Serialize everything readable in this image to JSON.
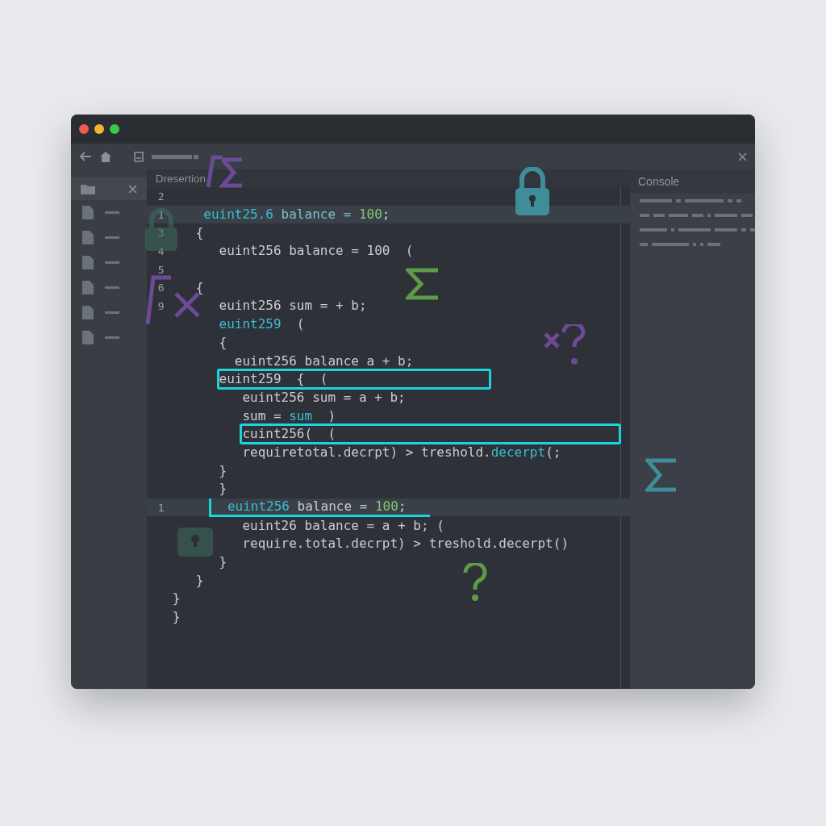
{
  "editor": {
    "tab_title": "Dresertion",
    "lines": [
      {
        "number": "2",
        "highlighted": false
      },
      {
        "number": "1",
        "highlighted": true,
        "tokens": [
          {
            "text": "    euint25.6",
            "kind": "type"
          },
          {
            "text": " balance = ",
            "kind": "ident"
          },
          {
            "text": "100",
            "kind": "number"
          },
          {
            "text": ";",
            "kind": "plain"
          }
        ]
      },
      {
        "number": "3",
        "highlighted": false,
        "tokens": [
          {
            "text": "   {",
            "kind": "plain"
          }
        ]
      },
      {
        "number": "4",
        "highlighted": false,
        "tokens": [
          {
            "text": "      euint256 balance = 100  (",
            "kind": "plain"
          }
        ]
      },
      {
        "number": "5",
        "highlighted": false
      },
      {
        "number": "6",
        "highlighted": false,
        "tokens": [
          {
            "text": "   {",
            "kind": "plain"
          }
        ]
      },
      {
        "number": "9",
        "highlighted": false,
        "tokens": [
          {
            "text": "      euint256 sum = + b;",
            "kind": "plain"
          }
        ]
      },
      {
        "highlighted": false,
        "tokens": [
          {
            "text": "      euint259",
            "kind": "type"
          },
          {
            "text": "  (",
            "kind": "plain"
          }
        ]
      },
      {
        "highlighted": false,
        "tokens": [
          {
            "text": "      {",
            "kind": "plain"
          }
        ]
      },
      {
        "highlighted": false,
        "tokens": [
          {
            "text": "        euint256 balance a + b;",
            "kind": "plain"
          }
        ]
      },
      {
        "highlighted": false,
        "kind": "boxed",
        "tokens": [
          {
            "text": "      euint259  {  (",
            "kind": "plain"
          }
        ]
      },
      {
        "highlighted": false,
        "tokens": [
          {
            "text": "         euint256 sum = a + b;",
            "kind": "plain"
          }
        ]
      },
      {
        "highlighted": false,
        "tokens": [
          {
            "text": "         sum = ",
            "kind": "plain"
          },
          {
            "text": "sum",
            "kind": "type"
          },
          {
            "text": "  )",
            "kind": "plain"
          }
        ]
      },
      {
        "highlighted": false,
        "kind": "wideboxed",
        "tokens": [
          {
            "text": "         cuint256(  (",
            "kind": "plain"
          }
        ]
      },
      {
        "highlighted": false,
        "tokens": [
          {
            "text": "         requiretotal.decrpt) > treshold.",
            "kind": "plain"
          },
          {
            "text": "decerpt",
            "kind": "type"
          },
          {
            "text": "(;",
            "kind": "plain"
          }
        ]
      },
      {
        "highlighted": false,
        "tokens": [
          {
            "text": "      }",
            "kind": "plain"
          }
        ]
      },
      {
        "highlighted": false,
        "tokens": [
          {
            "text": "      }",
            "kind": "plain"
          }
        ]
      },
      {
        "number": "1",
        "highlighted": true,
        "kind": "underlined",
        "tokens": [
          {
            "text": "     euint256",
            "kind": "type"
          },
          {
            "text": " balance = ",
            "kind": "plain"
          },
          {
            "text": "100",
            "kind": "number"
          },
          {
            "text": ";",
            "kind": "plain"
          }
        ]
      },
      {
        "highlighted": false,
        "tokens": [
          {
            "text": "         euint26 balance = a + b; (",
            "kind": "plain"
          }
        ]
      },
      {
        "highlighted": false,
        "tokens": [
          {
            "text": "         require.total.decrpt) > treshold.decerpt()",
            "kind": "plain"
          }
        ]
      },
      {
        "highlighted": false,
        "tokens": [
          {
            "text": "      }",
            "kind": "plain"
          }
        ]
      },
      {
        "highlighted": false,
        "tokens": [
          {
            "text": "   }",
            "kind": "plain"
          }
        ]
      },
      {
        "highlighted": false,
        "tokens": [
          {
            "text": "}",
            "kind": "plain"
          }
        ]
      },
      {
        "highlighted": false,
        "tokens": [
          {
            "text": "}",
            "kind": "plain"
          }
        ]
      }
    ]
  },
  "console": {
    "title": "Console"
  }
}
